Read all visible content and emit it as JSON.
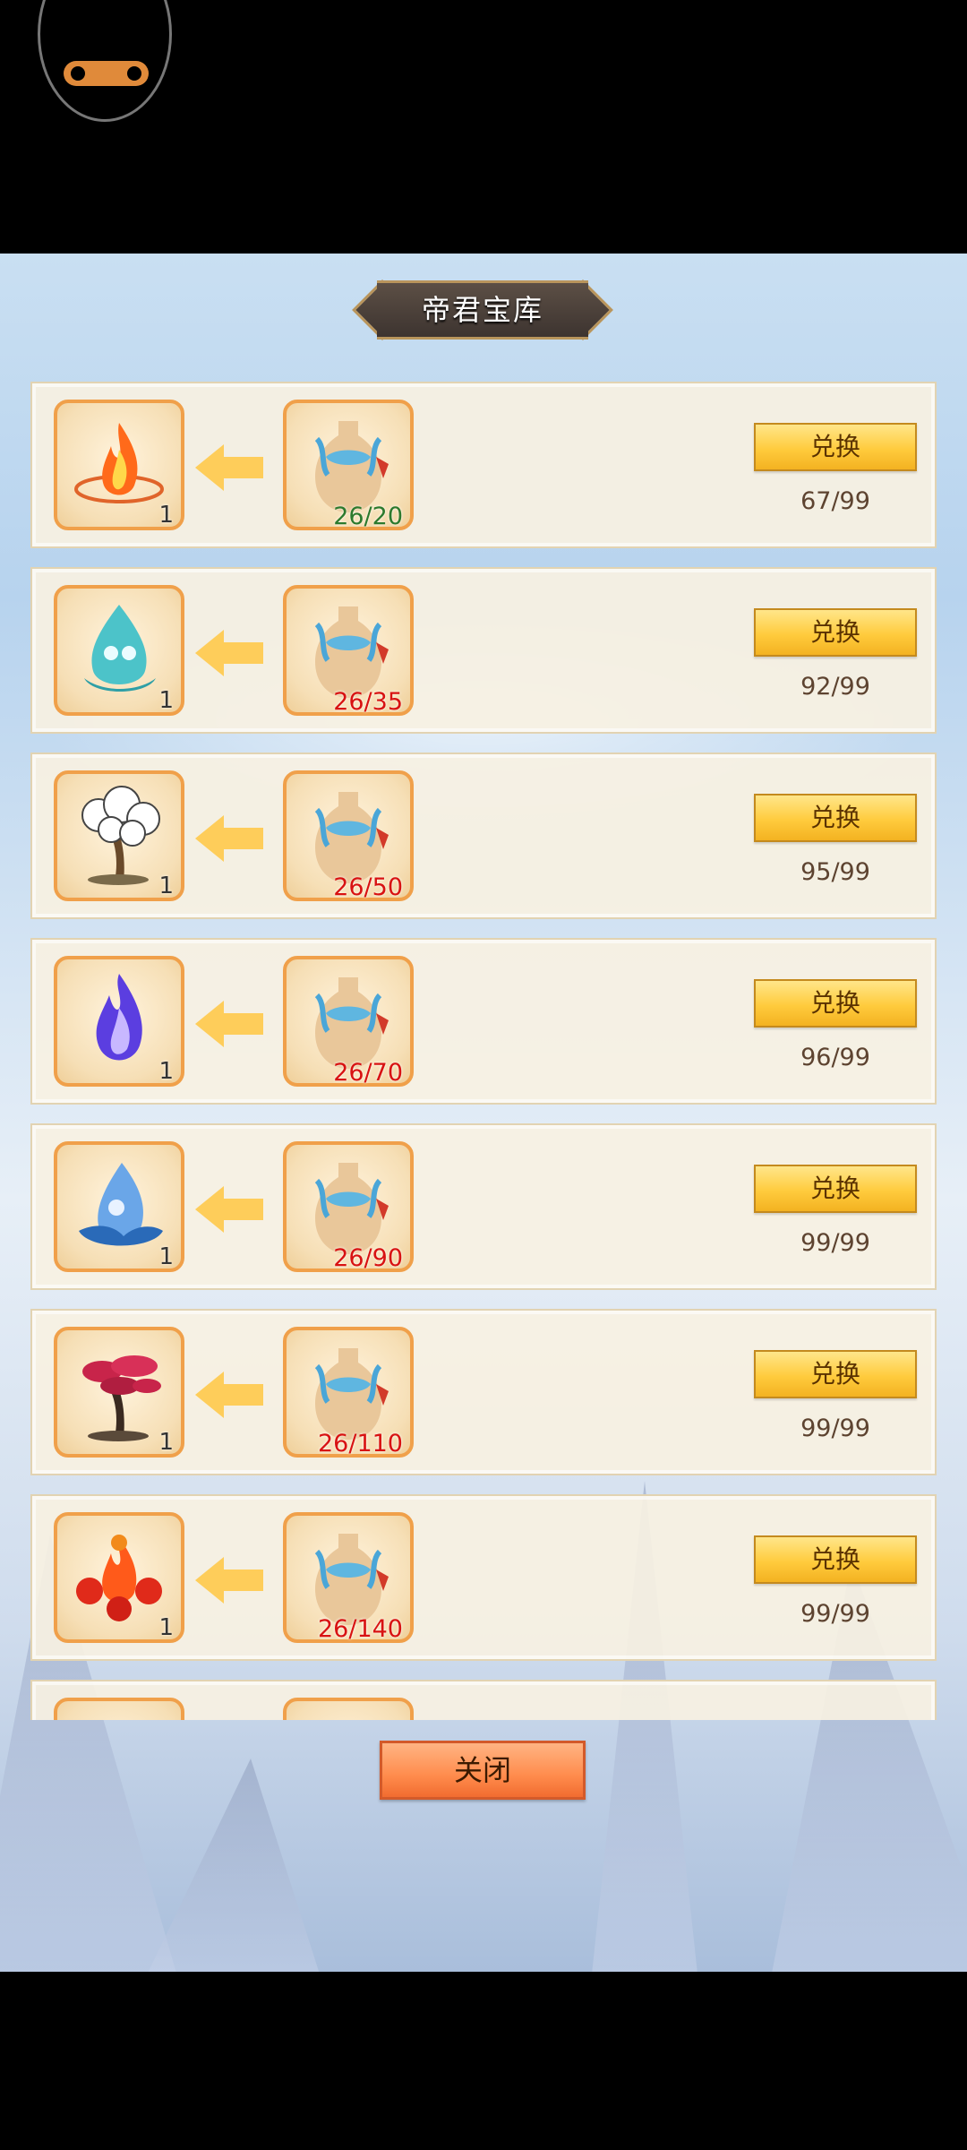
{
  "title": "帝君宝库",
  "colors": {
    "progress_ok": "#2d7a2d",
    "progress_short": "#d81212",
    "slot_border": "#f0a04a",
    "button_gold": "#ffcb3d",
    "close_orange": "#ff8c4d"
  },
  "rows": [
    {
      "reward_icon": "fire-icon",
      "reward_count": "1",
      "cost_icon": "vase-icon",
      "cost_progress": "26/20",
      "progress_state": "ok",
      "button_label": "兑换",
      "stock": "67/99"
    },
    {
      "reward_icon": "water-droplet-icon",
      "reward_count": "1",
      "cost_icon": "vase-icon",
      "cost_progress": "26/35",
      "progress_state": "short",
      "button_label": "兑换",
      "stock": "92/99"
    },
    {
      "reward_icon": "white-tree-icon",
      "reward_count": "1",
      "cost_icon": "vase-icon",
      "cost_progress": "26/50",
      "progress_state": "short",
      "button_label": "兑换",
      "stock": "95/99"
    },
    {
      "reward_icon": "blue-flame-icon",
      "reward_count": "1",
      "cost_icon": "vase-icon",
      "cost_progress": "26/70",
      "progress_state": "short",
      "button_label": "兑换",
      "stock": "96/99"
    },
    {
      "reward_icon": "water-spirit-icon",
      "reward_count": "1",
      "cost_icon": "vase-icon",
      "cost_progress": "26/90",
      "progress_state": "short",
      "button_label": "兑换",
      "stock": "99/99"
    },
    {
      "reward_icon": "red-tree-icon",
      "reward_count": "1",
      "cost_icon": "vase-icon",
      "cost_progress": "26/110",
      "progress_state": "short",
      "button_label": "兑换",
      "stock": "99/99"
    },
    {
      "reward_icon": "fire-orbs-icon",
      "reward_count": "1",
      "cost_icon": "vase-icon",
      "cost_progress": "26/140",
      "progress_state": "short",
      "button_label": "兑换",
      "stock": "99/99"
    }
  ],
  "close_label": "关闭"
}
